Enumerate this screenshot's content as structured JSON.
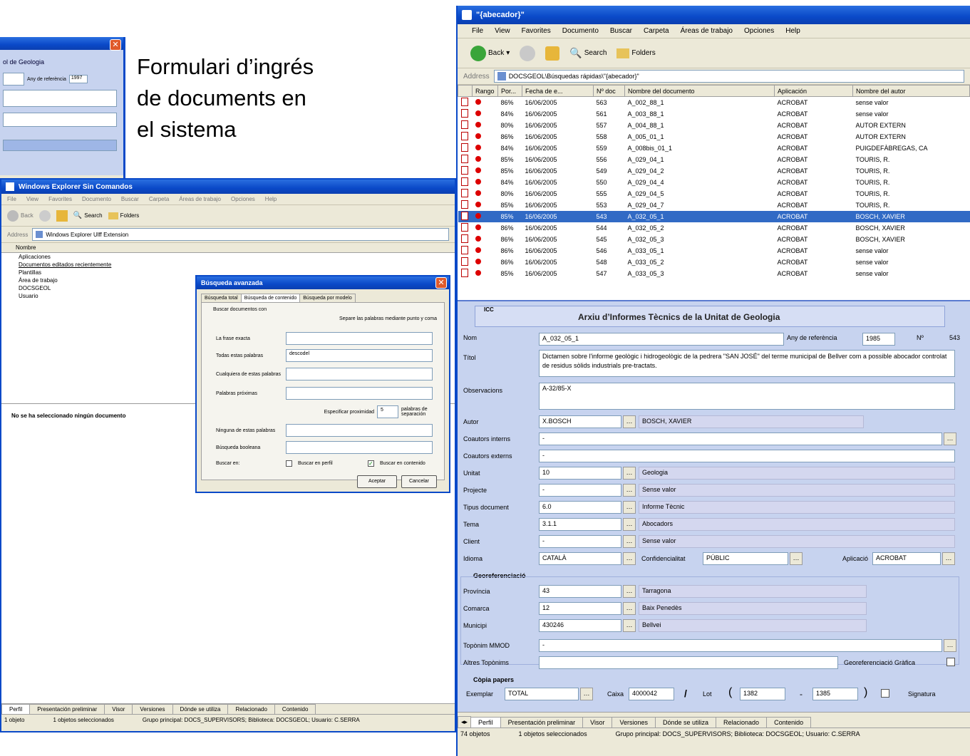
{
  "caption": {
    "line1": "Formulari d’ingrés",
    "line2": "de documents en",
    "line3": "el sistema"
  },
  "bg_form_window": {
    "title_fragment": "ol de Geologia",
    "field_fragment": "Any de referència",
    "year": "1997"
  },
  "explorer_window": {
    "title": "Windows Explorer Sin Comandos",
    "menu": [
      "File",
      "View",
      "Favorites",
      "Documento",
      "Buscar",
      "Carpeta",
      "Áreas de trabajo",
      "Opciones",
      "Help"
    ],
    "toolbar": {
      "back": "Back",
      "search": "Search",
      "folders": "Folders"
    },
    "address_label": "Address",
    "address": "Windows Explorer Ulff Extension",
    "tree_header": "Nombre",
    "tree": [
      "Aplicaciones",
      "Documentos editados recientemente",
      "Plantillas",
      "Área de trabajo",
      "DOCSGEOL",
      "Usuario"
    ],
    "empty_msg": "No se ha seleccionado ningún documento",
    "tabs": [
      "Perfil",
      "Presentación preliminar",
      "Visor",
      "Versiones",
      "Dónde se utiliza",
      "Relacionado",
      "Contenido"
    ],
    "status": [
      "1 objeto",
      "1 objetos seleccionados",
      "Grupo principal: DOCS_SUPERVISORS; Biblioteca: DOCSGEOL; Usuario: C.SERRA"
    ]
  },
  "search_dialog": {
    "title": "Búsqueda avanzada",
    "tabs": [
      "Búsqueda total",
      "Búsqueda de contenido",
      "Búsqueda por modelo"
    ],
    "group": "Buscar documentos con",
    "hint": "Separe las palabras mediante punto y coma",
    "fields": [
      {
        "label": "La frase exacta",
        "value": ""
      },
      {
        "label": "Todas estas palabras",
        "value": "descodel"
      },
      {
        "label": "Cualquiera de estas palabras",
        "value": ""
      },
      {
        "label": "Palabras próximas",
        "value": ""
      }
    ],
    "proximity_label": "Especificar proximidad",
    "proximity_value": "5",
    "proximity_unit": "palabras de separación",
    "extra_fields": [
      {
        "label": "Ninguna de estas palabras",
        "value": ""
      },
      {
        "label": "Búsqueda booleana",
        "value": ""
      }
    ],
    "search_in": "Buscar en:",
    "check1": "Buscar en perfil",
    "check2": "Buscar en contenido",
    "ok": "Aceptar",
    "cancel": "Cancelar"
  },
  "main_window": {
    "title": "\"{abecador}\"",
    "menu": [
      "File",
      "View",
      "Favorites",
      "Documento",
      "Buscar",
      "Carpeta",
      "Áreas de trabajo",
      "Opciones",
      "Help"
    ],
    "toolbar": {
      "back": "Back",
      "search": "Search",
      "folders": "Folders"
    },
    "address_label": "Address",
    "address": "DOCSGEOL\\Búsquedas rápidas\\\"{abecador}\"",
    "columns": [
      "Rango",
      "Por...",
      "Fecha de e...",
      "Nº doc",
      "Nombre del documento",
      "Aplicación",
      "Nombre del autor"
    ],
    "rows": [
      {
        "pct": "86%",
        "date": "16/06/2005",
        "num": "563",
        "name": "A_002_88_1",
        "app": "ACROBAT",
        "author": "sense valor"
      },
      {
        "pct": "84%",
        "date": "16/06/2005",
        "num": "561",
        "name": "A_003_88_1",
        "app": "ACROBAT",
        "author": "sense valor"
      },
      {
        "pct": "80%",
        "date": "16/06/2005",
        "num": "557",
        "name": "A_004_88_1",
        "app": "ACROBAT",
        "author": "AUTOR EXTERN"
      },
      {
        "pct": "86%",
        "date": "16/06/2005",
        "num": "558",
        "name": "A_005_01_1",
        "app": "ACROBAT",
        "author": "AUTOR EXTERN"
      },
      {
        "pct": "84%",
        "date": "16/06/2005",
        "num": "559",
        "name": "A_008bis_01_1",
        "app": "ACROBAT",
        "author": "PUIGDEFÀBREGAS, CA"
      },
      {
        "pct": "85%",
        "date": "16/06/2005",
        "num": "556",
        "name": "A_029_04_1",
        "app": "ACROBAT",
        "author": "TOURIS, R."
      },
      {
        "pct": "85%",
        "date": "16/06/2005",
        "num": "549",
        "name": "A_029_04_2",
        "app": "ACROBAT",
        "author": "TOURIS, R."
      },
      {
        "pct": "84%",
        "date": "16/06/2005",
        "num": "550",
        "name": "A_029_04_4",
        "app": "ACROBAT",
        "author": "TOURIS, R."
      },
      {
        "pct": "80%",
        "date": "16/06/2005",
        "num": "555",
        "name": "A_029_04_5",
        "app": "ACROBAT",
        "author": "TOURIS, R."
      },
      {
        "pct": "85%",
        "date": "16/06/2005",
        "num": "553",
        "name": "A_029_04_7",
        "app": "ACROBAT",
        "author": "TOURIS, R."
      },
      {
        "pct": "85%",
        "date": "16/06/2005",
        "num": "543",
        "name": "A_032_05_1",
        "app": "ACROBAT",
        "author": "BOSCH, XAVIER"
      },
      {
        "pct": "86%",
        "date": "16/06/2005",
        "num": "544",
        "name": "A_032_05_2",
        "app": "ACROBAT",
        "author": "BOSCH, XAVIER"
      },
      {
        "pct": "86%",
        "date": "16/06/2005",
        "num": "545",
        "name": "A_032_05_3",
        "app": "ACROBAT",
        "author": "BOSCH, XAVIER"
      },
      {
        "pct": "86%",
        "date": "16/06/2005",
        "num": "546",
        "name": "A_033_05_1",
        "app": "ACROBAT",
        "author": "sense valor"
      },
      {
        "pct": "86%",
        "date": "16/06/2005",
        "num": "548",
        "name": "A_033_05_2",
        "app": "ACROBAT",
        "author": "sense valor"
      },
      {
        "pct": "85%",
        "date": "16/06/2005",
        "num": "547",
        "name": "A_033_05_3",
        "app": "ACROBAT",
        "author": "sense valor"
      }
    ],
    "selected_row_index": 10,
    "form": {
      "logo": "ICC",
      "title": "Arxiu d’Informes Tècnics de la Unitat de Geologia",
      "nom_label": "Nom",
      "nom": "A_032_05_1",
      "any_label": "Any de referència",
      "any": "1985",
      "num_label": "Nº",
      "num": "543",
      "titol_label": "Títol",
      "titol": "Dictamen sobre l'informe geològic i hidrogeològic de la pedrera \"SAN JOSÉ\" del terme municipal de Bellver com a possible abocador controlat de residus sòlids industrials pre-tractats.",
      "obs_label": "Observacions",
      "obs": "A-32/85-X",
      "autor_label": "Autor",
      "autor_code": "X.BOSCH",
      "autor_name": "BOSCH, XAVIER",
      "cautors_int_label": "Coautors interns",
      "cautors_int": "-",
      "cautors_ext_label": "Coautors externs",
      "cautors_ext": "-",
      "unitat_label": "Unitat",
      "unitat_code": "10",
      "unitat_name": "Geologia",
      "projecte_label": "Projecte",
      "projecte_code": "-",
      "projecte_name": "Sense valor",
      "tipus_label": "Tipus document",
      "tipus_code": "6.0",
      "tipus_name": "Informe Tècnic",
      "tema_label": "Tema",
      "tema_code": "3.1.1",
      "tema_name": "Abocadors",
      "client_label": "Client",
      "client_code": "-",
      "client_name": "Sense valor",
      "idioma_label": "Idioma",
      "idioma": "CATALÀ",
      "conf_label": "Confidencialitat",
      "conf": "PÚBLIC",
      "aplic_label": "Aplicació",
      "aplic": "ACROBAT",
      "georef_label": "Georeferenciació",
      "prov_label": "Província",
      "prov_code": "43",
      "prov_name": "Tarragona",
      "comarca_label": "Comarca",
      "comarca_code": "12",
      "comarca_name": "Baix Penedès",
      "municipi_label": "Municipi",
      "municipi_code": "430246",
      "municipi_name": "Bellvei",
      "top_label": "Topònim MMOD",
      "top": "-",
      "altres_label": "Altres Topònims",
      "altres": "",
      "georef_graf": "Georeferenciació Gràfica",
      "copia_label": "Còpia papers",
      "exemplar_label": "Exemplar",
      "exemplar": "TOTAL",
      "caixa_label": "Caixa",
      "caixa": "4000042",
      "lot_label": "Lot",
      "lot1": "1382",
      "lot2": "1385",
      "signatura": "Signatura"
    },
    "tabs": [
      "Perfil",
      "Presentación preliminar",
      "Visor",
      "Versiones",
      "Dónde se utiliza",
      "Relacionado",
      "Contenido"
    ],
    "status": [
      "74 objetos",
      "1 objetos seleccionados",
      "Grupo principal: DOCS_SUPERVISORS; Biblioteca: DOCSGEOL; Usuario: C.SERRA"
    ]
  }
}
